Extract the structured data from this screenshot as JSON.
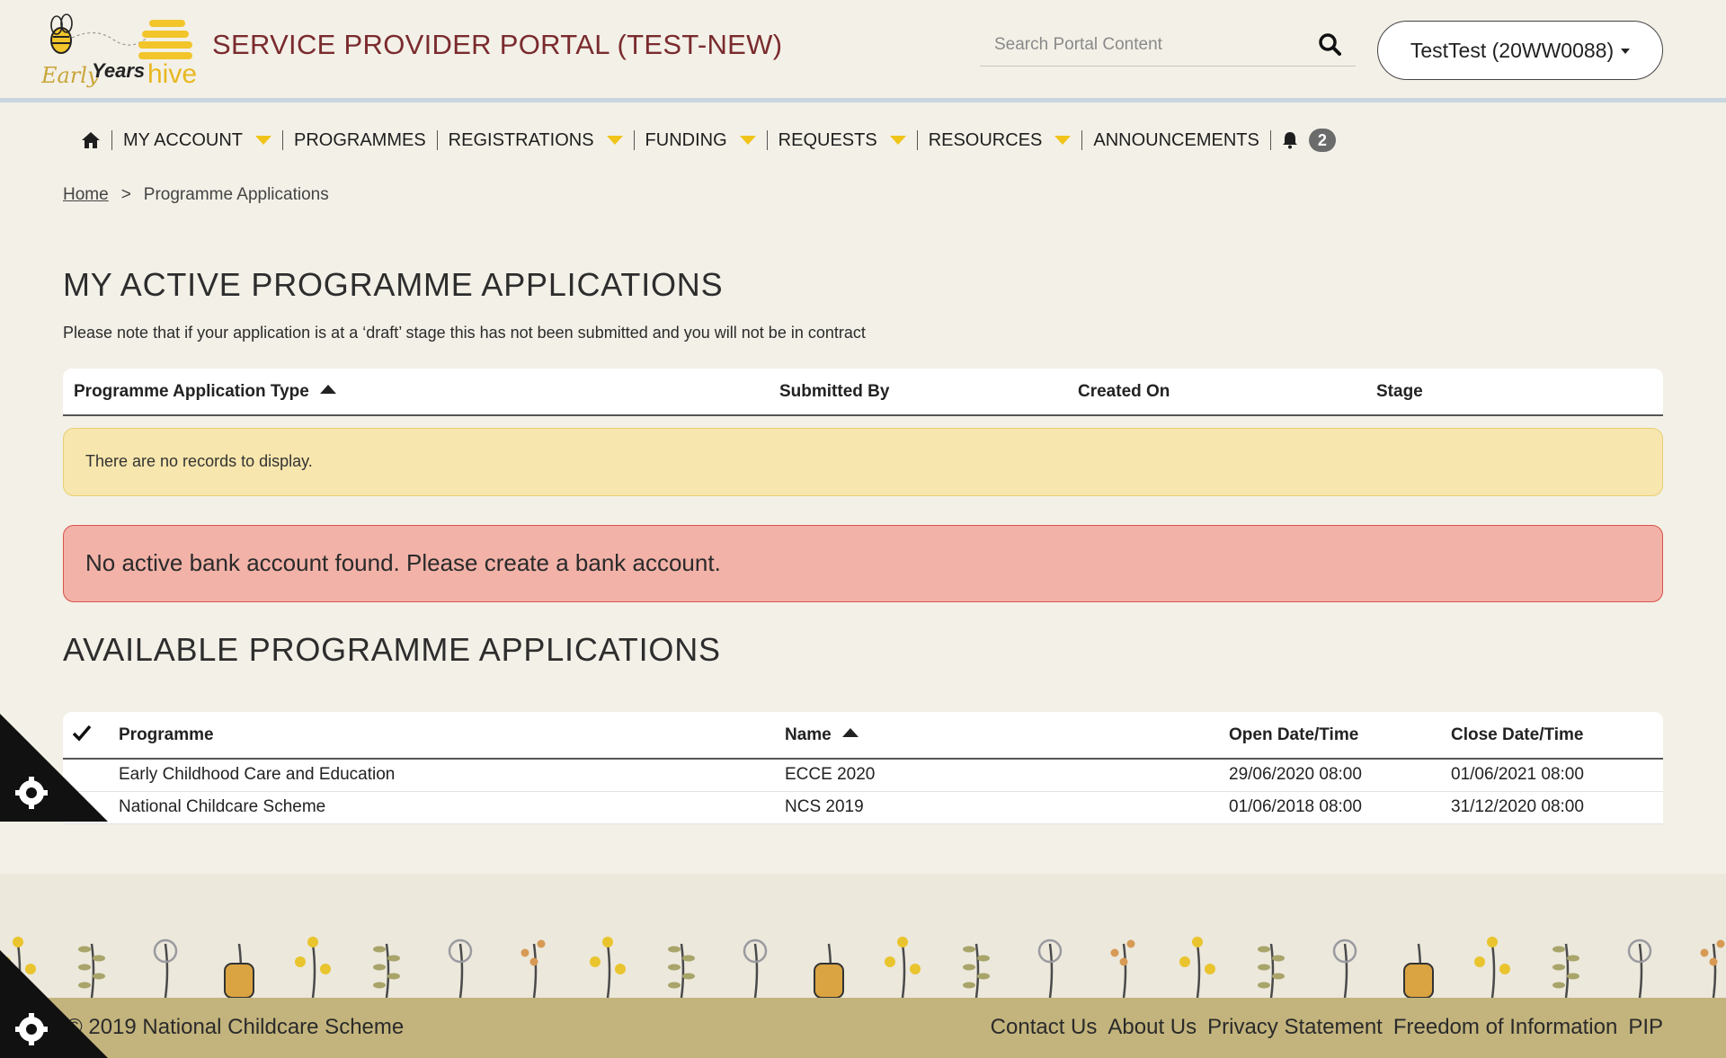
{
  "header": {
    "logo_text_early": "Early",
    "logo_text_years": "Years",
    "logo_text_hive": "hive",
    "title": "SERVICE PROVIDER PORTAL (TEST-NEW)",
    "search_placeholder": "Search Portal Content",
    "account_label": "TestTest (20WW0088)"
  },
  "nav": {
    "items": [
      {
        "label": "MY ACCOUNT",
        "has_dropdown": true
      },
      {
        "label": "PROGRAMMES",
        "has_dropdown": false
      },
      {
        "label": "REGISTRATIONS",
        "has_dropdown": true
      },
      {
        "label": "FUNDING",
        "has_dropdown": true
      },
      {
        "label": "REQUESTS",
        "has_dropdown": true
      },
      {
        "label": "RESOURCES",
        "has_dropdown": true
      },
      {
        "label": "ANNOUNCEMENTS",
        "has_dropdown": false
      }
    ],
    "notification_count": "2"
  },
  "breadcrumb": {
    "home": "Home",
    "separator": ">",
    "current": "Programme Applications"
  },
  "active_section": {
    "title": "MY ACTIVE PROGRAMME APPLICATIONS",
    "note": "Please note that if your application is at a ‘draft’ stage this has not been submitted and you will not be in contract",
    "columns": [
      "Programme Application Type",
      "Submitted By",
      "Created On",
      "Stage"
    ],
    "empty_message": "There are no records to display."
  },
  "bank_alert": "No active bank account found. Please create a bank account.",
  "available_section": {
    "title": "AVAILABLE PROGRAMME APPLICATIONS",
    "columns": [
      "Programme",
      "Name",
      "Open Date/Time",
      "Close Date/Time"
    ],
    "rows": [
      [
        "Early Childhood Care and Education",
        "ECCE 2020",
        "29/06/2020 08:00",
        "01/06/2021 08:00"
      ],
      [
        "National Childcare Scheme",
        "NCS 2019",
        "01/06/2018 08:00",
        "31/12/2020 08:00"
      ]
    ]
  },
  "footer": {
    "copyright": "© 2019 National Childcare Scheme",
    "links": [
      "Contact Us",
      "About Us",
      "Privacy Statement",
      "Freedom of Information",
      "PIP"
    ]
  },
  "colors": {
    "brand_red": "#7a2b2e",
    "nav_arrow": "#f0c419",
    "footer_bar": "#c3b47d",
    "warn_bg": "#f7e6ad",
    "danger_bg": "#f2b2a8"
  }
}
